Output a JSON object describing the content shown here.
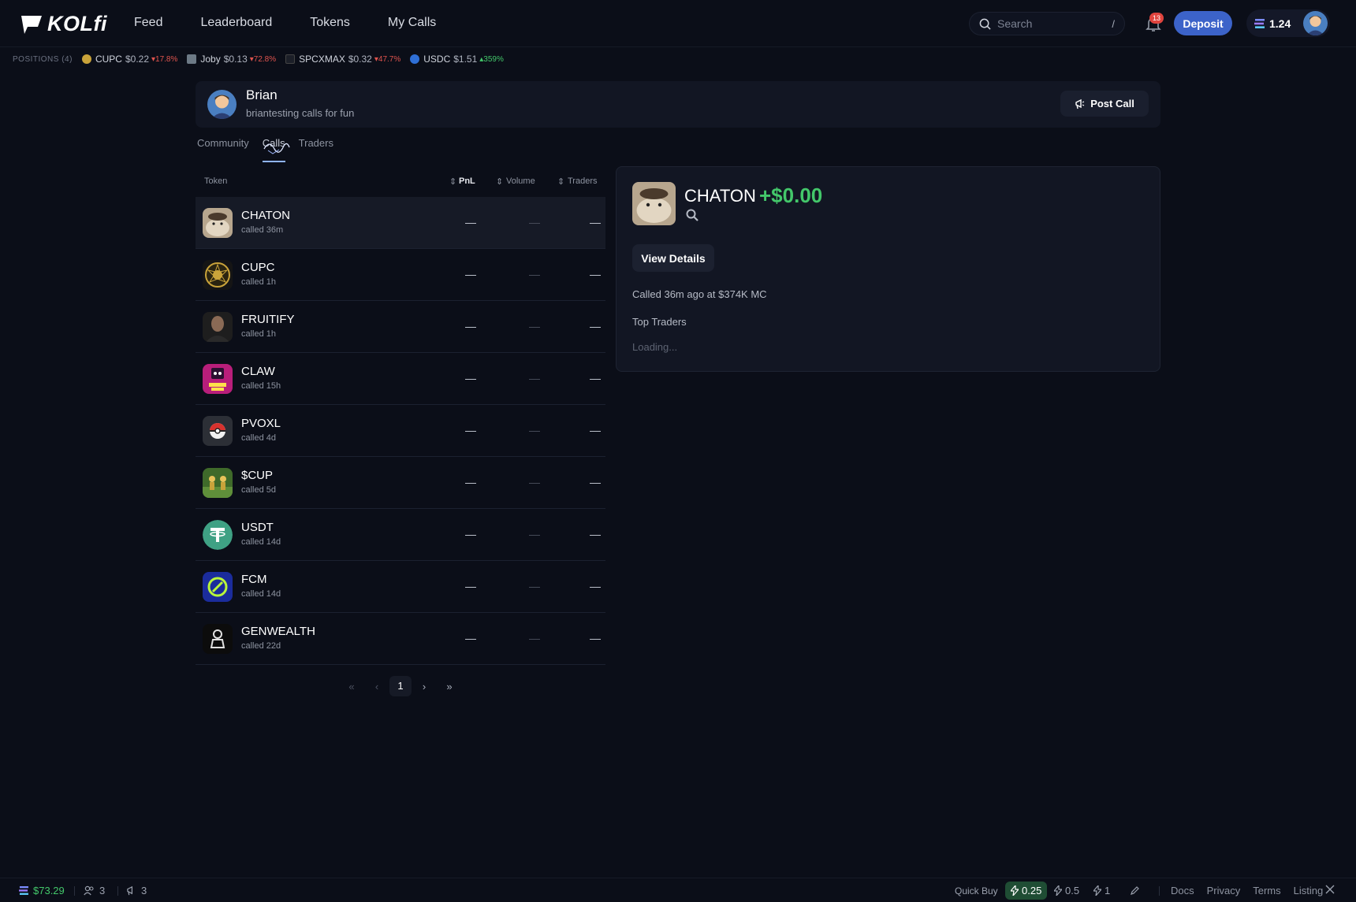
{
  "header": {
    "logo_text": "KOLfi",
    "nav": [
      "Feed",
      "Leaderboard",
      "Tokens",
      "My Calls"
    ],
    "search_placeholder": "Search",
    "search_shortcut": "/",
    "notification_count": "13",
    "deposit_label": "Deposit",
    "wallet_balance": "1.24"
  },
  "positions": {
    "label": "POSITIONS (4)",
    "items": [
      {
        "symbol": "CUPC",
        "price": "$0.22",
        "change": "▾17.8%",
        "direction": "down"
      },
      {
        "symbol": "Joby",
        "price": "$0.13",
        "change": "▾72.8%",
        "direction": "down"
      },
      {
        "symbol": "SPCXMAX",
        "price": "$0.32",
        "change": "▾47.7%",
        "direction": "down"
      },
      {
        "symbol": "USDC",
        "price": "$1.51",
        "change": "▴359%",
        "direction": "up"
      }
    ]
  },
  "profile": {
    "name": "Brian",
    "bio": "briantesting calls for fun",
    "post_call_label": "Post Call"
  },
  "tabs": {
    "items": [
      "Community",
      "Calls",
      "Traders"
    ],
    "active": "Calls"
  },
  "table": {
    "headers": {
      "token": "Token",
      "pnl": "PnL",
      "volume": "Volume",
      "traders": "Traders"
    },
    "rows": [
      {
        "name": "CHATON",
        "called": "called 36m",
        "pnl": "—",
        "volume": "—",
        "traders": "—"
      },
      {
        "name": "CUPC",
        "called": "called 1h",
        "pnl": "—",
        "volume": "—",
        "traders": "—"
      },
      {
        "name": "FRUITIFY",
        "called": "called 1h",
        "pnl": "—",
        "volume": "—",
        "traders": "—"
      },
      {
        "name": "CLAW",
        "called": "called 15h",
        "pnl": "—",
        "volume": "—",
        "traders": "—"
      },
      {
        "name": "PVOXL",
        "called": "called 4d",
        "pnl": "—",
        "volume": "—",
        "traders": "—"
      },
      {
        "name": "$CUP",
        "called": "called 5d",
        "pnl": "—",
        "volume": "—",
        "traders": "—"
      },
      {
        "name": "USDT",
        "called": "called 14d",
        "pnl": "—",
        "volume": "—",
        "traders": "—"
      },
      {
        "name": "FCM",
        "called": "called 14d",
        "pnl": "—",
        "volume": "—",
        "traders": "—"
      },
      {
        "name": "GENWEALTH",
        "called": "called 22d",
        "pnl": "—",
        "volume": "—",
        "traders": "—"
      }
    ],
    "pagination": {
      "first": "«",
      "prev": "‹",
      "page": "1",
      "next": "›",
      "last": "»"
    }
  },
  "detail": {
    "name": "CHATON",
    "pnl": "+$0.00",
    "view_details_label": "View Details",
    "called_text": "Called 36m ago at $374K MC",
    "top_traders_label": "Top Traders",
    "loading_text": "Loading..."
  },
  "footer": {
    "balance": "$73.29",
    "users_count": "3",
    "calls_count": "3",
    "quick_buy_label": "Quick Buy",
    "quick_buy_options": [
      "0.25",
      "0.5",
      "1"
    ],
    "links": [
      "Docs",
      "Privacy",
      "Terms",
      "Listing"
    ]
  },
  "colors": {
    "background": "#0b0e18",
    "accent": "#3c63c9",
    "positive": "#43c76a",
    "negative": "#e0544e"
  }
}
